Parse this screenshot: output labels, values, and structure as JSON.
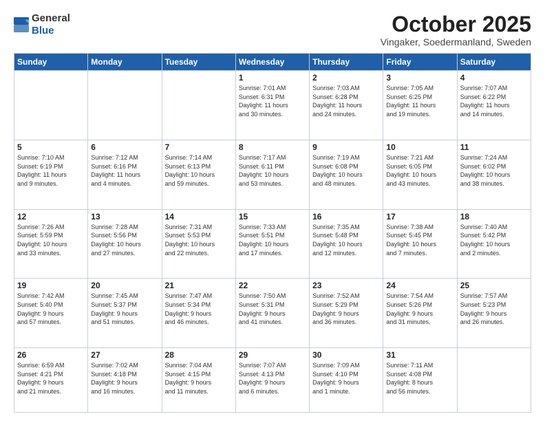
{
  "header": {
    "logo_general": "General",
    "logo_blue": "Blue",
    "month_title": "October 2025",
    "location": "Vingaker, Soedermanland, Sweden"
  },
  "days_of_week": [
    "Sunday",
    "Monday",
    "Tuesday",
    "Wednesday",
    "Thursday",
    "Friday",
    "Saturday"
  ],
  "weeks": [
    [
      {
        "day": "",
        "info": ""
      },
      {
        "day": "",
        "info": ""
      },
      {
        "day": "",
        "info": ""
      },
      {
        "day": "1",
        "info": "Sunrise: 7:01 AM\nSunset: 6:31 PM\nDaylight: 11 hours\nand 30 minutes."
      },
      {
        "day": "2",
        "info": "Sunrise: 7:03 AM\nSunset: 6:28 PM\nDaylight: 11 hours\nand 24 minutes."
      },
      {
        "day": "3",
        "info": "Sunrise: 7:05 AM\nSunset: 6:25 PM\nDaylight: 11 hours\nand 19 minutes."
      },
      {
        "day": "4",
        "info": "Sunrise: 7:07 AM\nSunset: 6:22 PM\nDaylight: 11 hours\nand 14 minutes."
      }
    ],
    [
      {
        "day": "5",
        "info": "Sunrise: 7:10 AM\nSunset: 6:19 PM\nDaylight: 11 hours\nand 9 minutes."
      },
      {
        "day": "6",
        "info": "Sunrise: 7:12 AM\nSunset: 6:16 PM\nDaylight: 11 hours\nand 4 minutes."
      },
      {
        "day": "7",
        "info": "Sunrise: 7:14 AM\nSunset: 6:13 PM\nDaylight: 10 hours\nand 59 minutes."
      },
      {
        "day": "8",
        "info": "Sunrise: 7:17 AM\nSunset: 6:11 PM\nDaylight: 10 hours\nand 53 minutes."
      },
      {
        "day": "9",
        "info": "Sunrise: 7:19 AM\nSunset: 6:08 PM\nDaylight: 10 hours\nand 48 minutes."
      },
      {
        "day": "10",
        "info": "Sunrise: 7:21 AM\nSunset: 6:05 PM\nDaylight: 10 hours\nand 43 minutes."
      },
      {
        "day": "11",
        "info": "Sunrise: 7:24 AM\nSunset: 6:02 PM\nDaylight: 10 hours\nand 38 minutes."
      }
    ],
    [
      {
        "day": "12",
        "info": "Sunrise: 7:26 AM\nSunset: 5:59 PM\nDaylight: 10 hours\nand 33 minutes."
      },
      {
        "day": "13",
        "info": "Sunrise: 7:28 AM\nSunset: 5:56 PM\nDaylight: 10 hours\nand 27 minutes."
      },
      {
        "day": "14",
        "info": "Sunrise: 7:31 AM\nSunset: 5:53 PM\nDaylight: 10 hours\nand 22 minutes."
      },
      {
        "day": "15",
        "info": "Sunrise: 7:33 AM\nSunset: 5:51 PM\nDaylight: 10 hours\nand 17 minutes."
      },
      {
        "day": "16",
        "info": "Sunrise: 7:35 AM\nSunset: 5:48 PM\nDaylight: 10 hours\nand 12 minutes."
      },
      {
        "day": "17",
        "info": "Sunrise: 7:38 AM\nSunset: 5:45 PM\nDaylight: 10 hours\nand 7 minutes."
      },
      {
        "day": "18",
        "info": "Sunrise: 7:40 AM\nSunset: 5:42 PM\nDaylight: 10 hours\nand 2 minutes."
      }
    ],
    [
      {
        "day": "19",
        "info": "Sunrise: 7:42 AM\nSunset: 5:40 PM\nDaylight: 9 hours\nand 57 minutes."
      },
      {
        "day": "20",
        "info": "Sunrise: 7:45 AM\nSunset: 5:37 PM\nDaylight: 9 hours\nand 51 minutes."
      },
      {
        "day": "21",
        "info": "Sunrise: 7:47 AM\nSunset: 5:34 PM\nDaylight: 9 hours\nand 46 minutes."
      },
      {
        "day": "22",
        "info": "Sunrise: 7:50 AM\nSunset: 5:31 PM\nDaylight: 9 hours\nand 41 minutes."
      },
      {
        "day": "23",
        "info": "Sunrise: 7:52 AM\nSunset: 5:29 PM\nDaylight: 9 hours\nand 36 minutes."
      },
      {
        "day": "24",
        "info": "Sunrise: 7:54 AM\nSunset: 5:26 PM\nDaylight: 9 hours\nand 31 minutes."
      },
      {
        "day": "25",
        "info": "Sunrise: 7:57 AM\nSunset: 5:23 PM\nDaylight: 9 hours\nand 26 minutes."
      }
    ],
    [
      {
        "day": "26",
        "info": "Sunrise: 6:59 AM\nSunset: 4:21 PM\nDaylight: 9 hours\nand 21 minutes."
      },
      {
        "day": "27",
        "info": "Sunrise: 7:02 AM\nSunset: 4:18 PM\nDaylight: 9 hours\nand 16 minutes."
      },
      {
        "day": "28",
        "info": "Sunrise: 7:04 AM\nSunset: 4:15 PM\nDaylight: 9 hours\nand 11 minutes."
      },
      {
        "day": "29",
        "info": "Sunrise: 7:07 AM\nSunset: 4:13 PM\nDaylight: 9 hours\nand 6 minutes."
      },
      {
        "day": "30",
        "info": "Sunrise: 7:09 AM\nSunset: 4:10 PM\nDaylight: 9 hours\nand 1 minute."
      },
      {
        "day": "31",
        "info": "Sunrise: 7:11 AM\nSunset: 4:08 PM\nDaylight: 8 hours\nand 56 minutes."
      },
      {
        "day": "",
        "info": ""
      }
    ]
  ]
}
